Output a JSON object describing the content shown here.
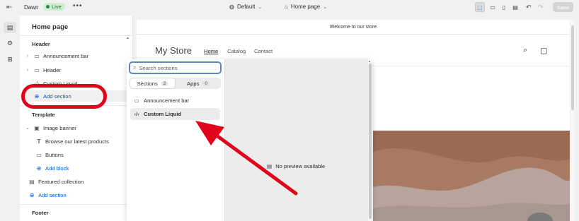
{
  "topbar": {
    "exit_icon": "exit-icon",
    "theme_name": "Dawn",
    "live_badge": "Live",
    "more_label": "•••",
    "device_selector": "Default",
    "page_selector": "Home page",
    "save_label": "Save"
  },
  "rail": {
    "items": [
      "sections-icon",
      "settings-icon",
      "apps-icon"
    ]
  },
  "sidebar": {
    "title": "Home page",
    "header_section_title": "Header",
    "header_items": [
      {
        "label": "Announcement bar",
        "icon": "layout-icon"
      },
      {
        "label": "Header",
        "icon": "layout-icon"
      },
      {
        "label": "Custom Liquid",
        "icon": "code-icon"
      }
    ],
    "add_section_label": "Add section",
    "template_section_title": "Template",
    "template_items": [
      {
        "label": "Image banner",
        "icon": "image-icon"
      },
      {
        "label": "Browse our latest products",
        "icon": "text-icon"
      },
      {
        "label": "Buttons",
        "icon": "button-icon"
      },
      {
        "label": "Add block",
        "icon": "add-icon"
      },
      {
        "label": "Featured collection",
        "icon": "collection-icon"
      },
      {
        "label": "Add section",
        "icon": "add-icon"
      }
    ],
    "footer_section_title": "Footer"
  },
  "storefront": {
    "announcement": "Welcome to our store",
    "store_name": "My Store",
    "nav": [
      "Home",
      "Catalog",
      "Contact"
    ],
    "colors": {
      "banner": "#9a6a55"
    }
  },
  "picker": {
    "search_placeholder": "Search sections",
    "tabs": [
      {
        "label": "Sections",
        "count": "2"
      },
      {
        "label": "Apps",
        "count": "0"
      }
    ],
    "items": [
      {
        "label": "Announcement bar",
        "icon": "layout-icon"
      },
      {
        "label": "Custom Liquid",
        "icon": "code-icon"
      }
    ],
    "no_preview": "No preview available"
  },
  "annotations": {
    "highlight_color": "#e0051b"
  }
}
